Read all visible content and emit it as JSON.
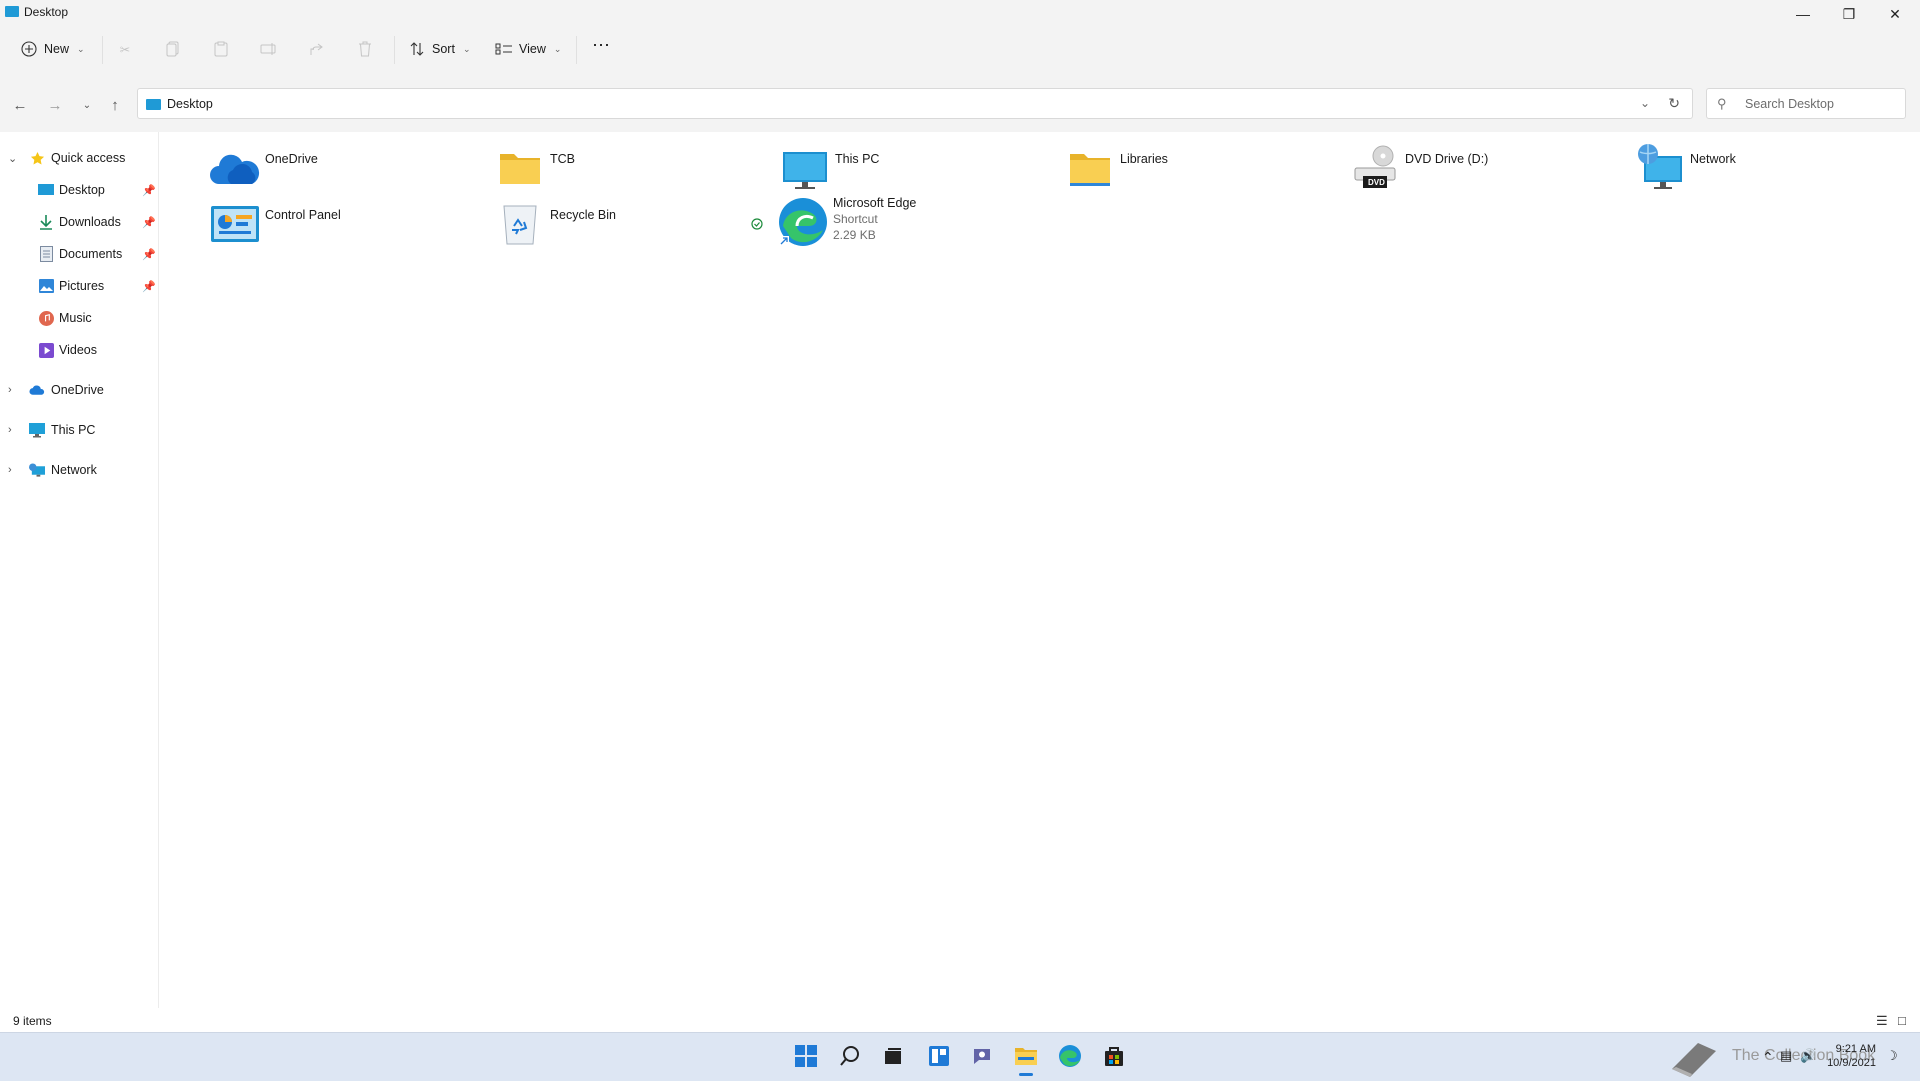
{
  "window": {
    "title": "Desktop"
  },
  "toolbar": {
    "new_label": "New",
    "sort_label": "Sort",
    "view_label": "View"
  },
  "address": {
    "crumb": "Desktop"
  },
  "search": {
    "placeholder": "Search Desktop"
  },
  "sidebar": {
    "quick_access": "Quick access",
    "pinned": [
      {
        "label": "Desktop",
        "icon": "desktop-icon",
        "pinned": true
      },
      {
        "label": "Downloads",
        "icon": "download-icon",
        "pinned": true
      },
      {
        "label": "Documents",
        "icon": "document-icon",
        "pinned": true
      },
      {
        "label": "Pictures",
        "icon": "picture-icon",
        "pinned": true
      },
      {
        "label": "Music",
        "icon": "music-icon",
        "pinned": false
      },
      {
        "label": "Videos",
        "icon": "video-icon",
        "pinned": false
      }
    ],
    "onedrive": "OneDrive",
    "this_pc": "This PC",
    "network": "Network"
  },
  "items": [
    {
      "name": "OneDrive",
      "icon": "onedrive-icon"
    },
    {
      "name": "TCB",
      "icon": "folder-icon"
    },
    {
      "name": "This PC",
      "icon": "monitor-icon"
    },
    {
      "name": "Libraries",
      "icon": "folder-icon"
    },
    {
      "name": "DVD Drive (D:)",
      "icon": "dvd-drive-icon",
      "badge": "DVD"
    },
    {
      "name": "Network",
      "icon": "network-icon"
    },
    {
      "name": "Control Panel",
      "icon": "control-panel-icon"
    },
    {
      "name": "Recycle Bin",
      "icon": "recycle-bin-icon"
    },
    {
      "name": "Microsoft Edge",
      "icon": "edge-icon",
      "type": "Shortcut",
      "size": "2.29 KB",
      "synced": true
    }
  ],
  "status": {
    "item_count": "9 items"
  },
  "taskbar": {
    "time": "9:21 AM",
    "date": "10/9/2021",
    "watermark": "The Collection Book"
  },
  "colors": {
    "accent": "#1f9ad6",
    "folder": "#f9c94a",
    "taskbar": "#dde6f3"
  }
}
